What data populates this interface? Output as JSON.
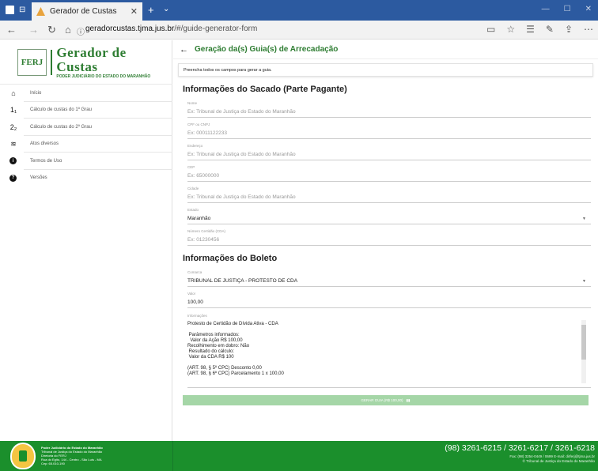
{
  "browser": {
    "tab_title": "Gerador de Custas",
    "tab_close": "✕",
    "new_tab": "+",
    "url_domain": "geradorcustas.tjma.jus.br",
    "url_path": "/#/guide-generator-form"
  },
  "sidebar": {
    "logo_ferj": "FERJ",
    "logo_title": "Gerador de Custas",
    "logo_subtitle": "PODER JUDICIÁRIO DO ESTADO DO MARANHÃO",
    "items": [
      {
        "label": "Início",
        "icon": "home-icon"
      },
      {
        "label": "Cálculo de custas do 1º Grau",
        "icon": "first-degree-icon"
      },
      {
        "label": "Cálculo de custas do 2º Grau",
        "icon": "second-degree-icon"
      },
      {
        "label": "Atos diversos",
        "icon": "layers-icon"
      },
      {
        "label": "Termos de Uso",
        "icon": "info-icon"
      },
      {
        "label": "Versões",
        "icon": "help-icon"
      }
    ]
  },
  "main": {
    "header_title": "Geração da(s) Guia(s) de Arrecadação",
    "notice": "Preencha todos os campos para gerar a guia.",
    "section1_title": "Informações do Sacado (Parte Pagante)",
    "fields1": [
      {
        "label": "Nome",
        "placeholder": "Ex: Tribunal de Justiça do Estado do Maranhão"
      },
      {
        "label": "CPF ou CNPJ",
        "placeholder": "Ex: 00011122233"
      },
      {
        "label": "Endereço",
        "placeholder": "Ex: Tribunal de Justiça do Estado do Maranhão"
      },
      {
        "label": "CEP",
        "placeholder": "Ex: 65000000"
      },
      {
        "label": "Cidade",
        "placeholder": "Ex: Tribunal de Justiça do Estado do Maranhão"
      },
      {
        "label": "Estado",
        "value": "Maranhão"
      },
      {
        "label": "Número Certidão (CDA)",
        "placeholder": "Ex: 01230456"
      }
    ],
    "section2_title": "Informações do Boleto",
    "comarca_label": "Comarca",
    "comarca_value": "TRIBUNAL DE JUSTIÇA - PROTESTO DE CDA",
    "valor_label": "Valor",
    "valor_value": "100,00",
    "info_label": "Informações",
    "info_text": "Protesto de Certidão de Dívida Ativa - CDA\n\n Parâmetros informados:\n  Valor da Ação R$ 100,00\nRecolhimento em dobro: Não\n Resultado do cálculo:\n Valor da CDA R$ 100\n\n(ART. 98, § 5º CPC) Desconto 0,00\n(ART. 98, § 6º CPC) Parcelamento 1 x 100,00",
    "generate_button": "GERAR GUIA (R$ 100,00)"
  },
  "footer": {
    "left_line1": "Poder Judiciário do Estado do Maranhão",
    "left_line2": "Tribunal de Justiça do Estado do Maranhão",
    "left_line3": "Diretoria do FERJ",
    "left_line4": "Rua do Egito, 144 - Centro - São Luís - MA",
    "left_line5": "Cep: 65.010-190",
    "phones": "(98) 3261-6215 / 3261-6217 / 3261-6218",
    "fax": "Fax: (98) 3254-0449 / 0699 E-mail: dirferj@tjma.jus.br",
    "copyright": "© Tribunal de Justiça do Estado do Maranhão"
  },
  "colors": {
    "tabbar": "#2c5aa0",
    "brand_green": "#2e7d32",
    "footer_green": "#1b8f2c",
    "button_disabled": "#a5d6a7"
  }
}
